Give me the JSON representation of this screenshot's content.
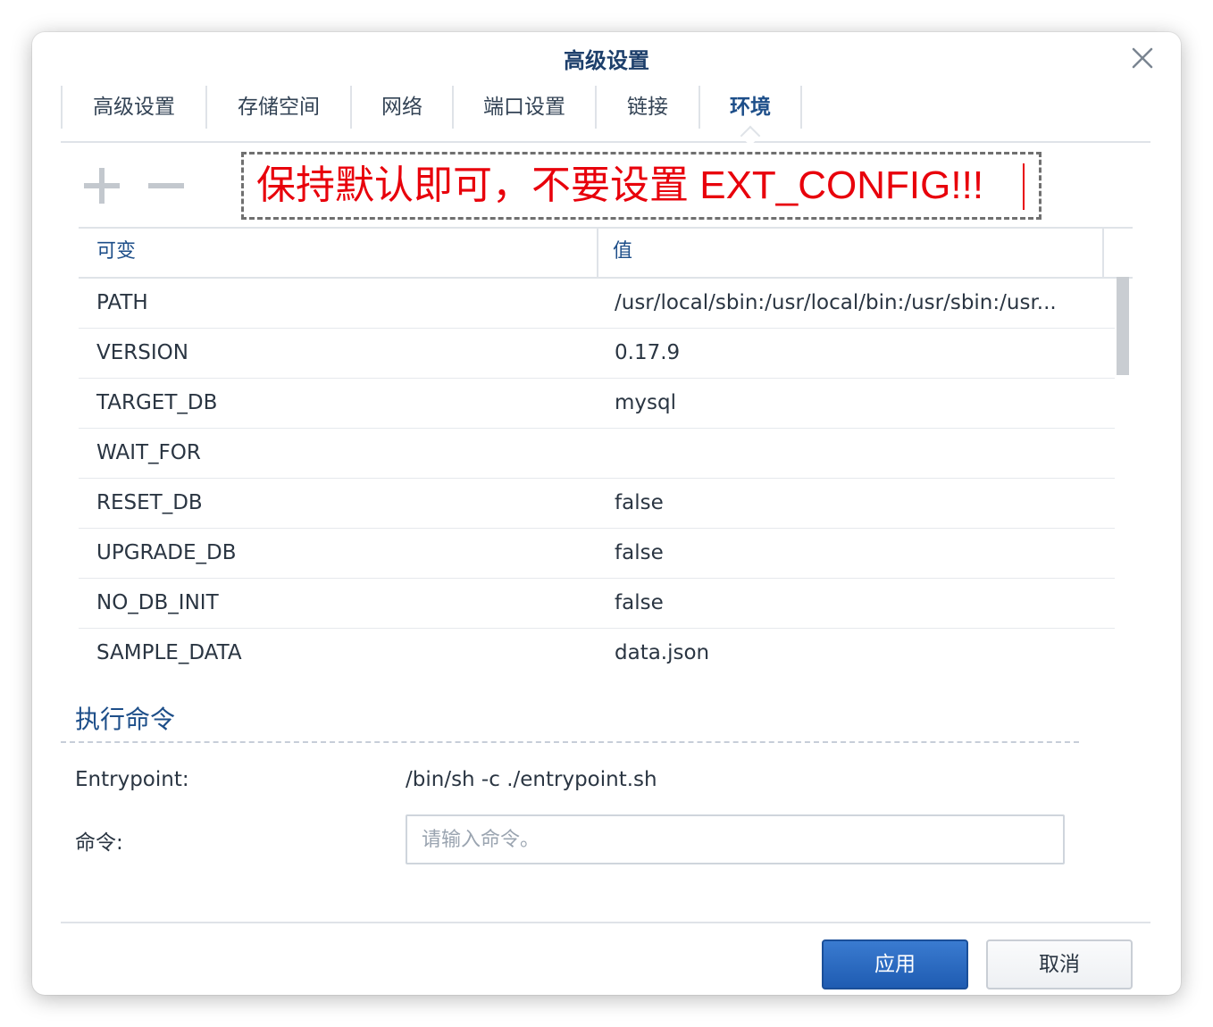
{
  "dialog": {
    "title": "高级设置"
  },
  "tabs": [
    {
      "label": "高级设置"
    },
    {
      "label": "存储空间"
    },
    {
      "label": "网络"
    },
    {
      "label": "端口设置"
    },
    {
      "label": "链接"
    },
    {
      "label": "环境",
      "active": true
    }
  ],
  "toolbar": {
    "add_icon": "plus-icon",
    "remove_icon": "minus-icon"
  },
  "annotation": {
    "text": "保持默认即可，不要设置 EXT_CONFIG!!!",
    "color": "#e8000b"
  },
  "env_table": {
    "columns": [
      "可变",
      "值"
    ],
    "rows": [
      {
        "variable": "PATH",
        "value": "/usr/local/sbin:/usr/local/bin:/usr/sbin:/usr..."
      },
      {
        "variable": "VERSION",
        "value": "0.17.9"
      },
      {
        "variable": "TARGET_DB",
        "value": "mysql"
      },
      {
        "variable": "WAIT_FOR",
        "value": ""
      },
      {
        "variable": "RESET_DB",
        "value": "false"
      },
      {
        "variable": "UPGRADE_DB",
        "value": "false"
      },
      {
        "variable": "NO_DB_INIT",
        "value": "false"
      },
      {
        "variable": "SAMPLE_DATA",
        "value": "data.json"
      }
    ]
  },
  "exec_section": {
    "title": "执行命令",
    "entrypoint_label": "Entrypoint:",
    "entrypoint_value": "/bin/sh -c ./entrypoint.sh",
    "command_label": "命令:",
    "command_value": "",
    "command_placeholder": "请输入命令。"
  },
  "footer": {
    "apply_label": "应用",
    "cancel_label": "取消"
  },
  "colors": {
    "accent": "#1d4e89",
    "primary_button": "#2a6bc4",
    "annotation_red": "#e8000b"
  }
}
